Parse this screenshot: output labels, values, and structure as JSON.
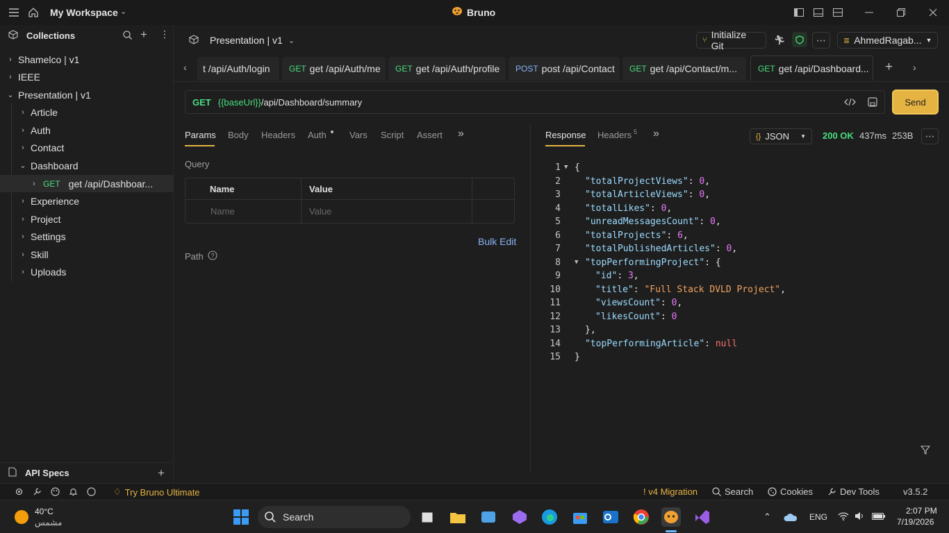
{
  "titlebar": {
    "workspace": "My Workspace",
    "app_title": "Bruno"
  },
  "sidebar": {
    "collections_title": "Collections",
    "tree": [
      {
        "label": "Shamelco | v1"
      },
      {
        "label": "IEEE"
      },
      {
        "label": "Presentation | v1"
      },
      {
        "label": "Article"
      },
      {
        "label": "Auth"
      },
      {
        "label": "Contact"
      },
      {
        "label": "Dashboard"
      },
      {
        "method": "GET",
        "label": "get /api/Dashboar..."
      },
      {
        "label": "Experience"
      },
      {
        "label": "Project"
      },
      {
        "label": "Settings"
      },
      {
        "label": "Skill"
      },
      {
        "label": "Uploads"
      }
    ],
    "api_specs": "API Specs"
  },
  "collection_bar": {
    "name": "Presentation | v1",
    "init_git": "Initialize Git",
    "user": "AhmedRagab..."
  },
  "tabs": [
    {
      "method": "",
      "label": "t /api/Auth/login"
    },
    {
      "method": "GET",
      "label": "get /api/Auth/me"
    },
    {
      "method": "GET",
      "label": "get /api/Auth/profile"
    },
    {
      "method": "POST",
      "label": "post /api/Contact"
    },
    {
      "method": "GET",
      "label": "get /api/Contact/m..."
    },
    {
      "method": "GET",
      "label": "get /api/Dashboard..."
    }
  ],
  "request": {
    "method": "GET",
    "url_var": "{{baseUrl}}",
    "url_path": "/api/Dashboard/summary",
    "send_label": "Send",
    "pane_tabs": [
      "Params",
      "Body",
      "Headers",
      "Auth",
      "Vars",
      "Script",
      "Assert"
    ],
    "query_label": "Query",
    "col_name": "Name",
    "col_value": "Value",
    "ph_name": "Name",
    "ph_value": "Value",
    "bulk_edit": "Bulk Edit",
    "path_label": "Path"
  },
  "response": {
    "tab_response": "Response",
    "tab_headers": "Headers",
    "headers_count": "5",
    "format": "JSON",
    "status": "200 OK",
    "time": "437ms",
    "size": "253B",
    "lines": [
      {
        "n": "1",
        "fold": true,
        "indent": 0,
        "parts": [
          [
            "p",
            "{"
          ]
        ]
      },
      {
        "n": "2",
        "indent": 1,
        "parts": [
          [
            "k",
            "\"totalProjectViews\""
          ],
          [
            "p",
            ": "
          ],
          [
            "n",
            "0"
          ],
          [
            "p",
            ","
          ]
        ]
      },
      {
        "n": "3",
        "indent": 1,
        "parts": [
          [
            "k",
            "\"totalArticleViews\""
          ],
          [
            "p",
            ": "
          ],
          [
            "n",
            "0"
          ],
          [
            "p",
            ","
          ]
        ]
      },
      {
        "n": "4",
        "indent": 1,
        "parts": [
          [
            "k",
            "\"totalLikes\""
          ],
          [
            "p",
            ": "
          ],
          [
            "n",
            "0"
          ],
          [
            "p",
            ","
          ]
        ]
      },
      {
        "n": "5",
        "indent": 1,
        "parts": [
          [
            "k",
            "\"unreadMessagesCount\""
          ],
          [
            "p",
            ": "
          ],
          [
            "n",
            "0"
          ],
          [
            "p",
            ","
          ]
        ]
      },
      {
        "n": "6",
        "indent": 1,
        "parts": [
          [
            "k",
            "\"totalProjects\""
          ],
          [
            "p",
            ": "
          ],
          [
            "n",
            "6"
          ],
          [
            "p",
            ","
          ]
        ]
      },
      {
        "n": "7",
        "indent": 1,
        "parts": [
          [
            "k",
            "\"totalPublishedArticles\""
          ],
          [
            "p",
            ": "
          ],
          [
            "n",
            "0"
          ],
          [
            "p",
            ","
          ]
        ]
      },
      {
        "n": "8",
        "fold": true,
        "indent": 1,
        "parts": [
          [
            "k",
            "\"topPerformingProject\""
          ],
          [
            "p",
            ": {"
          ]
        ]
      },
      {
        "n": "9",
        "indent": 2,
        "parts": [
          [
            "k",
            "\"id\""
          ],
          [
            "p",
            ": "
          ],
          [
            "n",
            "3"
          ],
          [
            "p",
            ","
          ]
        ]
      },
      {
        "n": "10",
        "indent": 2,
        "parts": [
          [
            "k",
            "\"title\""
          ],
          [
            "p",
            ": "
          ],
          [
            "s",
            "\"Full Stack DVLD Project\""
          ],
          [
            "p",
            ","
          ]
        ]
      },
      {
        "n": "11",
        "indent": 2,
        "parts": [
          [
            "k",
            "\"viewsCount\""
          ],
          [
            "p",
            ": "
          ],
          [
            "n",
            "0"
          ],
          [
            "p",
            ","
          ]
        ]
      },
      {
        "n": "12",
        "indent": 2,
        "parts": [
          [
            "k",
            "\"likesCount\""
          ],
          [
            "p",
            ": "
          ],
          [
            "n",
            "0"
          ]
        ]
      },
      {
        "n": "13",
        "indent": 1,
        "parts": [
          [
            "p",
            "},"
          ]
        ]
      },
      {
        "n": "14",
        "indent": 1,
        "parts": [
          [
            "k",
            "\"topPerformingArticle\""
          ],
          [
            "p",
            ": "
          ],
          [
            "nl",
            "null"
          ]
        ]
      },
      {
        "n": "15",
        "indent": 0,
        "parts": [
          [
            "p",
            "}"
          ]
        ]
      }
    ]
  },
  "statusbar": {
    "try_ultimate": "Try Bruno Ultimate",
    "migration": "! v4 Migration",
    "search": "Search",
    "cookies": "Cookies",
    "dev_tools": "Dev Tools",
    "version": "v3.5.2"
  },
  "taskbar": {
    "temp": "40°C",
    "weather": "مشمس",
    "search": "Search",
    "lang": "ENG",
    "time": "2:07 PM",
    "date": "7/19/2026"
  }
}
